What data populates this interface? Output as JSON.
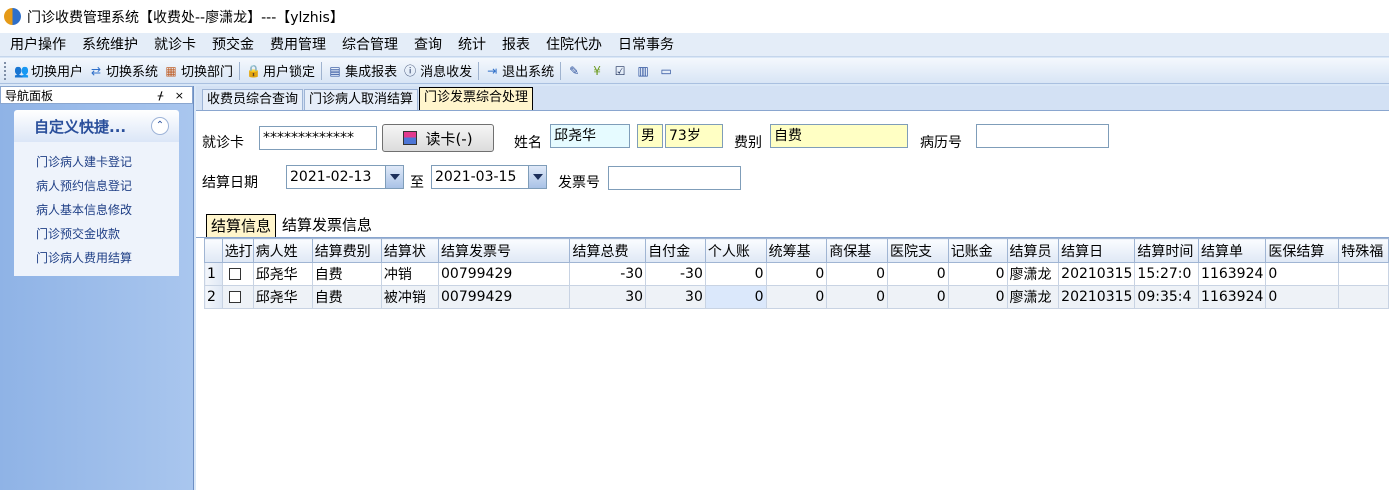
{
  "window": {
    "title": "门诊收费管理系统【收费处--廖潇龙】---【ylzhis】"
  },
  "menu": [
    "用户操作",
    "系统维护",
    "就诊卡",
    "预交金",
    "费用管理",
    "综合管理",
    "查询",
    "统计",
    "报表",
    "住院代办",
    "日常事务"
  ],
  "toolbar": {
    "buttons": [
      {
        "label": "切换用户",
        "icon": "users-icon"
      },
      {
        "label": "切换系统",
        "icon": "switch-system-icon"
      },
      {
        "label": "切换部门",
        "icon": "department-icon"
      },
      {
        "label": "用户锁定",
        "icon": "user-lock-icon"
      },
      {
        "label": "集成报表",
        "icon": "report-icon"
      },
      {
        "label": "消息收发",
        "icon": "message-icon"
      },
      {
        "label": "退出系统",
        "icon": "exit-icon"
      }
    ]
  },
  "nav": {
    "panel_title": "导航面板",
    "pin_close": "ᚋ ×",
    "group_title": "自定义快捷...",
    "collapse_glyph": "⌃",
    "links": [
      "门诊病人建卡登记",
      "病人预约信息登记",
      "病人基本信息修改",
      "门诊预交金收款",
      "门诊病人费用结算"
    ]
  },
  "doc_tabs": [
    "收费员综合查询",
    "门诊病人取消结算",
    "门诊发票综合处理"
  ],
  "form": {
    "card_label": "就诊卡",
    "card_value": "*************",
    "read_card_button": "读卡(-)",
    "name_label": "姓名",
    "name_value": "邱尧华",
    "gender_value": "男",
    "age_value": "73岁",
    "fee_type_label": "费别",
    "fee_type_value": "自费",
    "record_no_label": "病历号",
    "record_no_value": "",
    "settle_date_label": "结算日期",
    "date_from": "2021-02-13",
    "to_label": "至",
    "date_to": "2021-03-15",
    "invoice_no_label": "发票号",
    "invoice_no_value": ""
  },
  "grid_tabs": [
    "结算信息",
    "结算发票信息"
  ],
  "table": {
    "headers": [
      "选打",
      "病人姓",
      "结算费别",
      "结算状",
      "结算发票号",
      "结算总费",
      "自付金",
      "个人账",
      "统筹基",
      "商保基",
      "医院支",
      "记账金",
      "结算员",
      "结算日",
      "结算时间",
      "结算单",
      "医保结算",
      "特殊福"
    ],
    "rows": [
      {
        "no": "1",
        "name": "邱尧华",
        "fee_type": "自费",
        "status": "冲销",
        "invoice": "00799429",
        "total": "-30",
        "self_pay": "-30",
        "personal": "0",
        "pooled": "0",
        "commercial": "0",
        "hospital": "0",
        "account": "0",
        "operator": "廖潇龙",
        "date": "20210315",
        "time": "15:27:0",
        "bill_no": "1163924",
        "insurance": "0",
        "special": ""
      },
      {
        "no": "2",
        "name": "邱尧华",
        "fee_type": "自费",
        "status": "被冲销",
        "invoice": "00799429",
        "total": "30",
        "self_pay": "30",
        "personal": "0",
        "pooled": "0",
        "commercial": "0",
        "hospital": "0",
        "account": "0",
        "operator": "廖潇龙",
        "date": "20210315",
        "time": "09:35:4",
        "bill_no": "1163924",
        "insurance": "0",
        "special": ""
      }
    ]
  }
}
